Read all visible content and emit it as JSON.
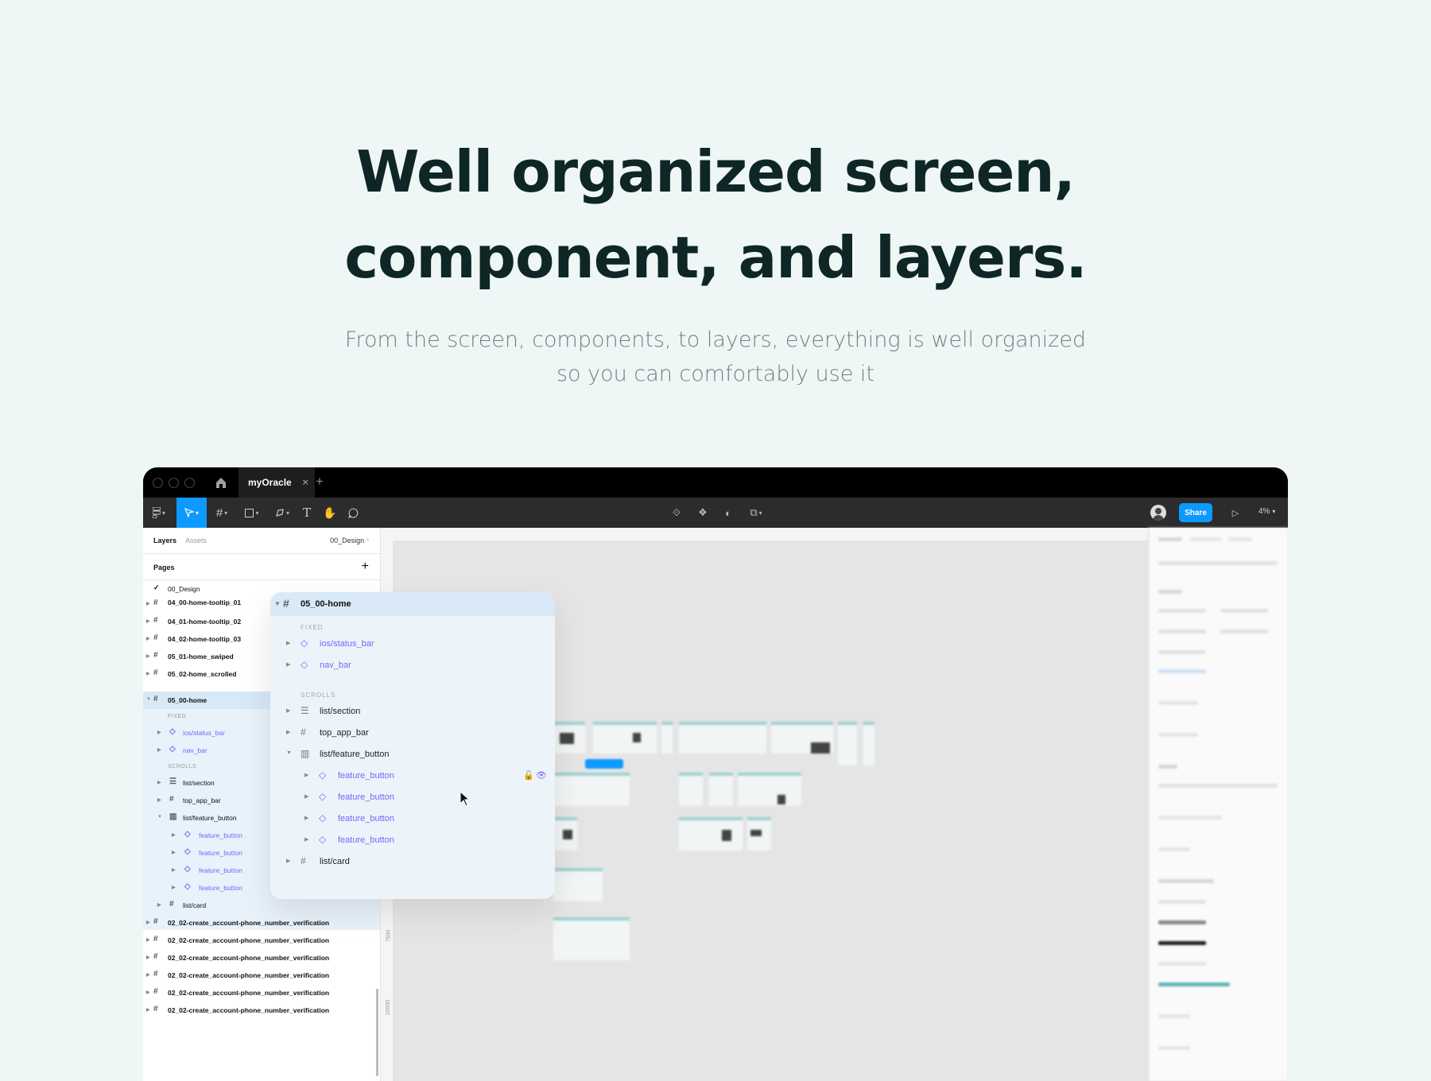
{
  "hero": {
    "title_line1": "Well organized screen,",
    "title_line2": "component, and layers.",
    "subtitle_line1": "From the screen, components, to layers, everything is well organized",
    "subtitle_line2": "so you can comfortably use it"
  },
  "app": {
    "tab_title": "myOracle",
    "share_label": "Share",
    "zoom": "4%"
  },
  "left_panel": {
    "tabs": [
      "Layers",
      "Assets"
    ],
    "current_page": "00_Design",
    "pages_label": "Pages",
    "page_item": "00_Design",
    "layers": [
      "04_00-home-tooltip_01",
      "04_01-home-tooltip_02",
      "04_02-home-tooltip_03",
      "05_01-home_swiped",
      "05_02-home_scrolled",
      "05_00-home"
    ],
    "fixed_label": "FIXED",
    "scrolls_label": "SCROLLS",
    "children": {
      "status_bar": "ios/status_bar",
      "nav_bar": "nav_bar",
      "list_section": "list/section",
      "top_app_bar": "top_app_bar",
      "list_feature_button": "list/feature_button",
      "feature_button": "feature_button",
      "list_card": "list/card"
    },
    "bottom_layers": [
      "02_02-create_account-phone_number_verification",
      "02_02-create_account-phone_number_verification",
      "02_02-create_account-phone_number_verification",
      "02_02-create_account-phone_number_verification",
      "02_02-create_account-phone_number_verification",
      "02_02-create_account-phone_number_verification"
    ]
  },
  "popup": {
    "frame": "05_00-home",
    "fixed_label": "FIXED",
    "scrolls_label": "SCROLLS",
    "status_bar": "ios/status_bar",
    "nav_bar": "nav_bar",
    "list_section": "list/section",
    "top_app_bar": "top_app_bar",
    "list_feature_button": "list/feature_button",
    "feature_buttons": [
      "feature_button",
      "feature_button",
      "feature_button",
      "feature_button"
    ],
    "list_card": "list/card"
  },
  "ruler": {
    "v_marks": [
      "7500",
      "10000"
    ]
  },
  "colors": {
    "accent": "#0d99ff",
    "component": "#7b61ff",
    "heading": "#0e2626"
  }
}
